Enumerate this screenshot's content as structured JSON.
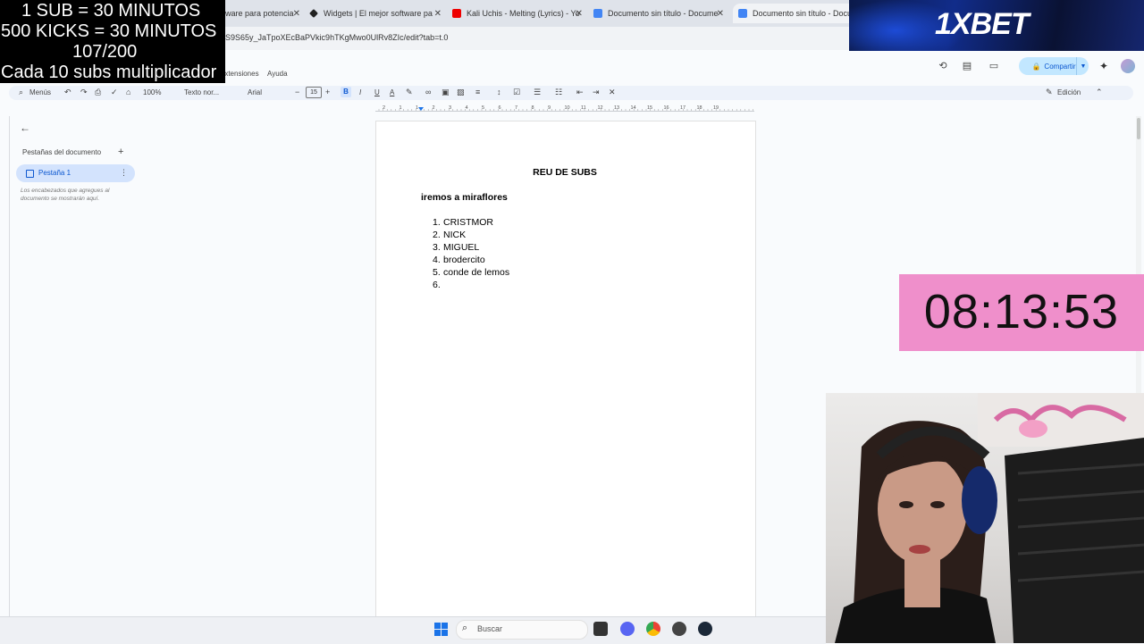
{
  "browser": {
    "tabs": [
      {
        "label": "ware para potencia",
        "icon": "app-icon"
      },
      {
        "label": "Widgets | El mejor software pa",
        "icon": "diamond-icon"
      },
      {
        "label": "Kali Uchis - Melting (Lyrics) - Yo",
        "icon": "youtube-icon"
      },
      {
        "label": "Documento sin título - Docume",
        "icon": "docs-icon"
      },
      {
        "label": "Documento sin título - Docum",
        "icon": "docs-icon"
      }
    ],
    "url": "S9S65y_JaTpoXEcBaPVkic9hTKgMwo0UlRv8ZIc/edit?tab=t.0"
  },
  "docs": {
    "menu": {
      "extensions": "Extensiones",
      "help": "Ayuda"
    },
    "share_label": "Compartir",
    "toolbar": {
      "menus": "Menús",
      "zoom": "100%",
      "style": "Texto nor...",
      "font": "Arial",
      "font_size": "15",
      "bold": "B",
      "italic": "I",
      "underline": "U",
      "text_color": "A",
      "edit_mode": "Edición"
    },
    "sidebar": {
      "title": "Pestañas del documento",
      "tab_label": "Pestaña 1",
      "hint": "Los encabezados que agregues al documento se mostrarán aquí."
    },
    "ruler_numbers": [
      "2",
      "1",
      "1",
      "2",
      "3",
      "4",
      "5",
      "6",
      "7",
      "8",
      "9",
      "10",
      "11",
      "12",
      "13",
      "14",
      "15",
      "16",
      "17",
      "18",
      "19"
    ],
    "document": {
      "title": "REU DE SUBS",
      "subtitle": "iremos a miraflores",
      "list": [
        {
          "n": "1.",
          "text": "CRISTMOR"
        },
        {
          "n": "2.",
          "text": "NICK"
        },
        {
          "n": "3.",
          "text": "MIGUEL"
        },
        {
          "n": "4.",
          "text": "brodercito"
        },
        {
          "n": "5.",
          "text": "conde de lemos"
        },
        {
          "n": "6.",
          "text": ""
        }
      ]
    }
  },
  "overlay": {
    "lines": [
      "1 SUB      = 30 MINUTOS",
      "500 KICKS = 30 MINUTOS",
      "107/200",
      "Cada 10 subs multiplicador"
    ],
    "brand": "1XBET",
    "timer": "08:13:53",
    "timer_color": "#ef8fcb"
  },
  "taskbar": {
    "search_placeholder": "Buscar"
  }
}
